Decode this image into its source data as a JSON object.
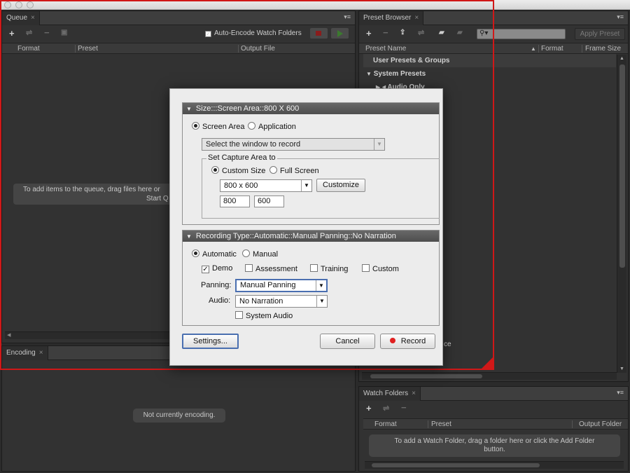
{
  "queue": {
    "tab": "Queue",
    "auto_encode_label": "Auto-Encode Watch Folders",
    "columns": [
      "Format",
      "Preset",
      "Output File"
    ],
    "empty_text": "To add items to the queue, drag files here or",
    "empty_text_2": "Start Q"
  },
  "encoding": {
    "tab": "Encoding",
    "status": "Not currently encoding."
  },
  "preset_browser": {
    "tab": "Preset Browser",
    "apply_label": "Apply Preset",
    "columns": [
      "Preset Name",
      "Format",
      "Frame Size"
    ],
    "rows": [
      "User Presets & Groups",
      "System Presets",
      "Audio Only"
    ],
    "partial_1": "y",
    "partial_2": "ce"
  },
  "watch_folders": {
    "tab": "Watch Folders",
    "columns": [
      "Format",
      "Preset",
      "Output Folder"
    ],
    "empty_text": "To add a Watch Folder, drag a folder here or click the Add Folder",
    "empty_text_2": "button."
  },
  "dialog": {
    "size_header": "Size:::Screen Area::800 X 600",
    "screen_area": "Screen Area",
    "application": "Application",
    "window_select": "Select the window to record",
    "capture_group": "Set Capture Area to",
    "custom_size": "Custom Size",
    "full_screen": "Full Screen",
    "size_select": "800 x 600",
    "customize": "Customize",
    "width": "800",
    "height": "600",
    "rec_header": "Recording Type::Automatic::Manual Panning::No Narration",
    "automatic": "Automatic",
    "manual": "Manual",
    "demo": "Demo",
    "assessment": "Assessment",
    "training": "Training",
    "custom": "Custom",
    "panning_label": "Panning:",
    "panning_value": "Manual Panning",
    "audio_label": "Audio:",
    "audio_value": "No Narration",
    "system_audio": "System Audio",
    "settings": "Settings...",
    "cancel": "Cancel",
    "record": "Record"
  },
  "colors": {
    "capture_frame": "#d01818",
    "record_dot": "#e02020"
  }
}
